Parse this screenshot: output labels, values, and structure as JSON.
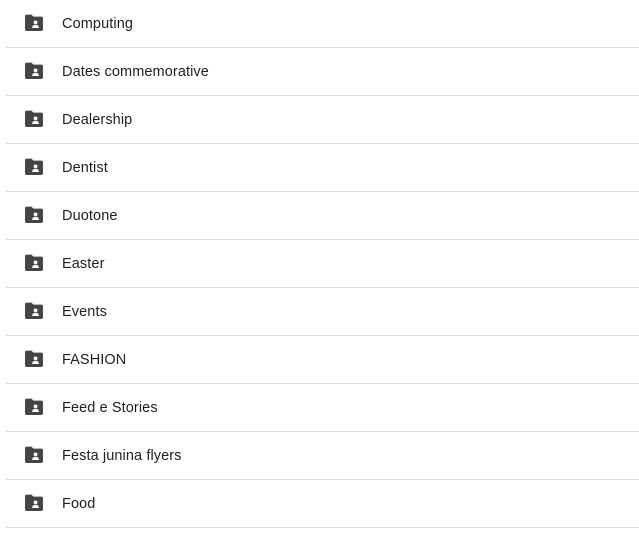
{
  "folders": [
    {
      "name": "Computing",
      "icon": "shared-folder-icon"
    },
    {
      "name": "Dates commemorative",
      "icon": "shared-folder-icon"
    },
    {
      "name": "Dealership",
      "icon": "shared-folder-icon"
    },
    {
      "name": "Dentist",
      "icon": "shared-folder-icon"
    },
    {
      "name": "Duotone",
      "icon": "shared-folder-icon"
    },
    {
      "name": "Easter",
      "icon": "shared-folder-icon"
    },
    {
      "name": "Events",
      "icon": "shared-folder-icon"
    },
    {
      "name": "FASHION",
      "icon": "shared-folder-icon"
    },
    {
      "name": "Feed e Stories",
      "icon": "shared-folder-icon"
    },
    {
      "name": "Festa junina flyers",
      "icon": "shared-folder-icon"
    },
    {
      "name": "Food",
      "icon": "shared-folder-icon"
    }
  ],
  "colors": {
    "icon": "#444746",
    "divider": "#dadce0",
    "text": "#1f1f1f"
  }
}
